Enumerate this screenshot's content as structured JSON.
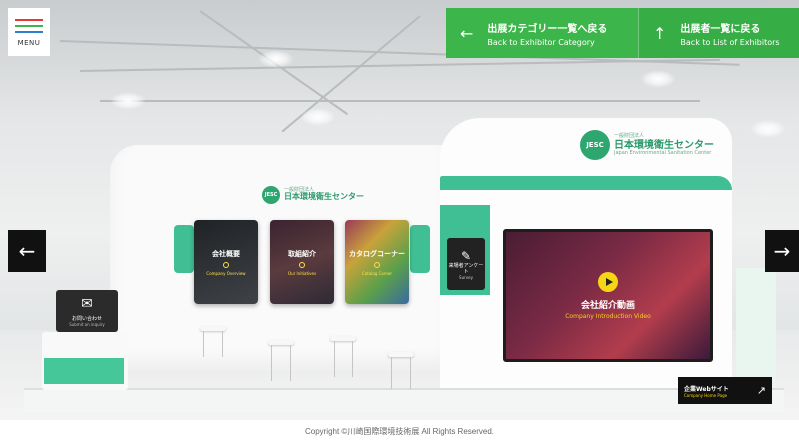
{
  "menu": {
    "label": "MENU",
    "bar_colors": [
      "#e5383b",
      "#3cb64a",
      "#2f7fd0"
    ]
  },
  "nav": {
    "category": {
      "jp": "出展カテゴリー一覧へ戻る",
      "en": "Back to Exhibitor Category",
      "icon": "arrow-left-icon"
    },
    "list": {
      "jp": "出展者一覧に戻る",
      "en": "Back to List of Exhibitors",
      "icon": "arrow-up-icon"
    }
  },
  "booth": {
    "logo_big": {
      "mark": "JESC",
      "sub": "一般財団法人",
      "name": "日本環境衛生センター",
      "en": "Japan Environmental Sanitation Center"
    },
    "logo_small": {
      "mark": "JESC",
      "sub": "一般財団法人",
      "name": "日本環境衛生センター"
    },
    "panels": [
      {
        "jp": "会社概要",
        "en": "Company Overview"
      },
      {
        "jp": "取組紹介",
        "en": "Our Initiatives"
      },
      {
        "jp": "カタログコーナー",
        "en": "Catalog Corner"
      }
    ],
    "survey": {
      "jp": "来場者アンケート",
      "en": "Survey"
    },
    "video": {
      "jp": "会社紹介動画",
      "en": "Company Introduction Video"
    },
    "inquiry": {
      "jp": "お問い合わせ",
      "en": "Submit an inquiry"
    },
    "web": {
      "jp": "企業Webサイト",
      "en": "Company Home Page"
    }
  },
  "footer": {
    "copyright": "Copyright ©川崎国際環境技術展 All Rights Reserved."
  },
  "colors": {
    "nav_green": "#3cb64a",
    "booth_green": "#3fbf93",
    "accent_yellow": "#f6d515"
  }
}
